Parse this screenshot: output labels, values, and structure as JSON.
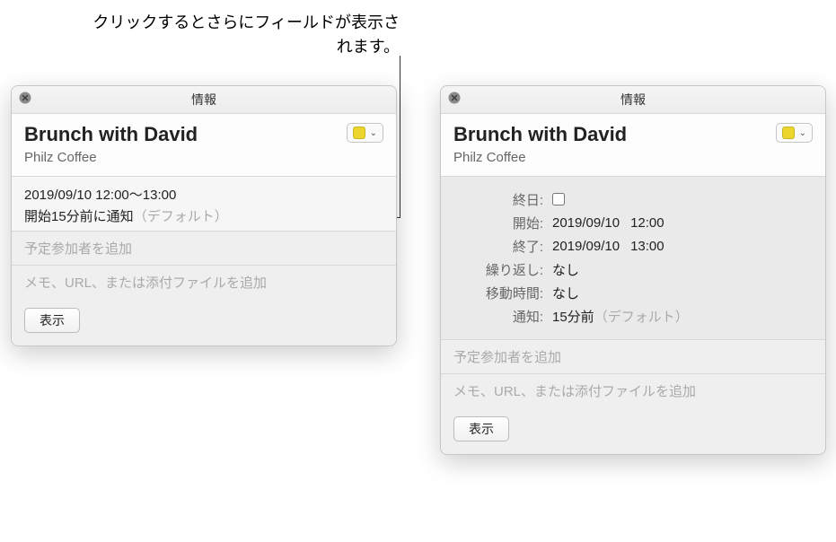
{
  "annotation": "クリックするとさらにフィールドが表示されます。",
  "window_title": "情報",
  "event": {
    "title": "Brunch with David",
    "location": "Philz Coffee"
  },
  "calendar_color": "#ecd62e",
  "compact": {
    "datetime": "2019/09/10 12:00～13:00",
    "alarm_text": "開始15分前に通知",
    "alarm_default": "（デフォルト）"
  },
  "expanded": {
    "allday_label": "終日:",
    "allday_checked": false,
    "start_label": "開始:",
    "start_date": "2019/09/10",
    "start_time": "12:00",
    "end_label": "終了:",
    "end_date": "2019/09/10",
    "end_time": "13:00",
    "repeat_label": "繰り返し:",
    "repeat_value": "なし",
    "travel_label": "移動時間:",
    "travel_value": "なし",
    "alarm_label": "通知:",
    "alarm_value": "15分前",
    "alarm_default": "（デフォルト）"
  },
  "invitees_placeholder": "予定参加者を追加",
  "notes_placeholder": "メモ、URL、または添付ファイルを追加",
  "show_button": "表示"
}
